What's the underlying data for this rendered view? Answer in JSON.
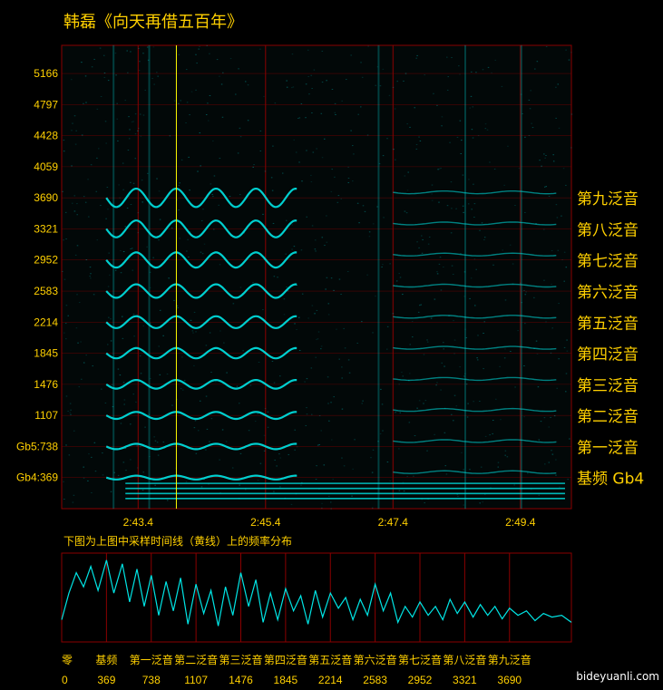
{
  "title": "韩磊《向天再借五百年》",
  "caption": "下图为上图中采样时间线（黄线）上的频率分布",
  "watermark": "bideyuanli.com",
  "colors": {
    "signal": "#00e5e5",
    "text": "#ffd000",
    "grid": "#8a0000",
    "timeline": "#ffff00"
  },
  "chart_data": [
    {
      "type": "heatmap",
      "title": "韩磊《向天再借五百年》",
      "y_ticks": [
        "5166",
        "4797",
        "4428",
        "4059",
        "3690",
        "3321",
        "2952",
        "2583",
        "2214",
        "1845",
        "1476",
        "1107",
        "Gb5:738",
        "Gb4:369"
      ],
      "y_tick_values": [
        5166,
        4797,
        4428,
        4059,
        3690,
        3321,
        2952,
        2583,
        2214,
        1845,
        1476,
        1107,
        738,
        369
      ],
      "ylim": [
        0,
        5500
      ],
      "x_ticks": [
        "2:43.4",
        "2:45.4",
        "2:47.4",
        "2:49.4"
      ],
      "x_tick_values": [
        163.4,
        165.4,
        167.4,
        169.4
      ],
      "xlim": [
        162.2,
        170.2
      ],
      "sample_time": 164.0,
      "harmonic_labels": [
        "第九泛音",
        "第八泛音",
        "第七泛音",
        "第六泛音",
        "第五泛音",
        "第四泛音",
        "第三泛音",
        "第二泛音",
        "第一泛音",
        "基频 Gb4"
      ],
      "harmonic_freqs": [
        3690,
        3321,
        2952,
        2583,
        2214,
        1845,
        1476,
        1107,
        738,
        369
      ],
      "grid": true
    },
    {
      "type": "line",
      "title": "下图为上图中采样时间线（黄线）上的频率分布",
      "x_labels": [
        "零",
        "基频",
        "第一泛音",
        "第二泛音",
        "第三泛音",
        "第四泛音",
        "第五泛音",
        "第六泛音",
        "第七泛音",
        "第八泛音",
        "第九泛音"
      ],
      "x_ticks": [
        "0",
        "369",
        "738",
        "1107",
        "1476",
        "1845",
        "2214",
        "2583",
        "2952",
        "3321",
        "3690"
      ],
      "x_tick_values": [
        0,
        369,
        738,
        1107,
        1476,
        1845,
        2214,
        2583,
        2952,
        3321,
        3690
      ],
      "xlim": [
        0,
        4200
      ],
      "ylim": [
        0,
        1
      ],
      "grid": true,
      "series": [
        {
          "x": [
            0,
            60,
            120,
            180,
            240,
            300,
            369,
            430,
            500,
            560,
            620,
            680,
            738,
            800,
            860,
            920,
            980,
            1040,
            1107,
            1170,
            1230,
            1290,
            1350,
            1410,
            1476,
            1540,
            1600,
            1660,
            1720,
            1780,
            1845,
            1910,
            1970,
            2030,
            2090,
            2150,
            2214,
            2280,
            2340,
            2400,
            2460,
            2520,
            2583,
            2650,
            2710,
            2770,
            2830,
            2890,
            2952,
            3020,
            3080,
            3140,
            3200,
            3260,
            3321,
            3390,
            3450,
            3510,
            3570,
            3630,
            3690,
            3760,
            3830,
            3900,
            3970,
            4040,
            4120,
            4200
          ],
          "values": [
            0.25,
            0.55,
            0.78,
            0.62,
            0.85,
            0.58,
            0.92,
            0.55,
            0.88,
            0.45,
            0.82,
            0.4,
            0.75,
            0.3,
            0.68,
            0.35,
            0.72,
            0.2,
            0.65,
            0.32,
            0.58,
            0.18,
            0.62,
            0.3,
            0.78,
            0.4,
            0.7,
            0.22,
            0.55,
            0.25,
            0.6,
            0.35,
            0.52,
            0.2,
            0.58,
            0.28,
            0.55,
            0.38,
            0.5,
            0.25,
            0.48,
            0.3,
            0.65,
            0.35,
            0.55,
            0.22,
            0.4,
            0.28,
            0.45,
            0.3,
            0.4,
            0.25,
            0.48,
            0.32,
            0.45,
            0.28,
            0.42,
            0.3,
            0.4,
            0.26,
            0.38,
            0.3,
            0.35,
            0.24,
            0.32,
            0.28,
            0.3,
            0.22
          ]
        }
      ]
    }
  ]
}
